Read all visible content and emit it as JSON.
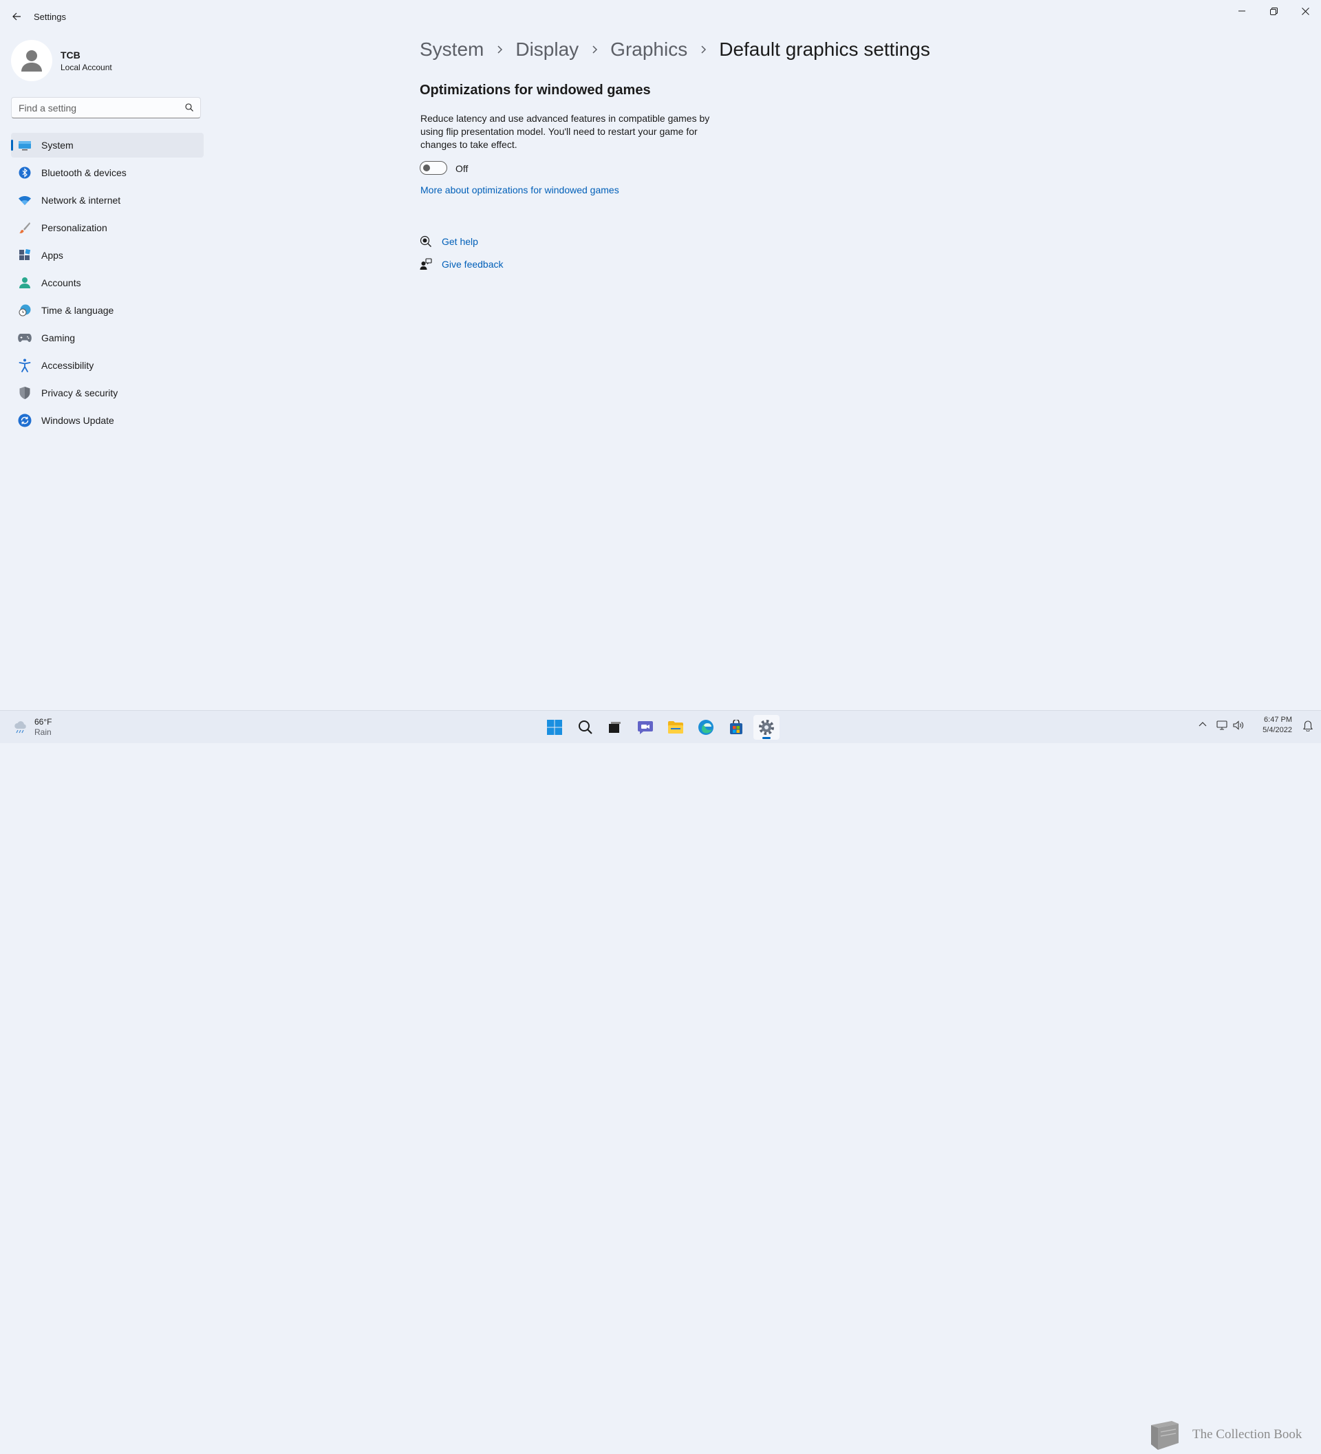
{
  "window": {
    "app_title": "Settings",
    "controls": {
      "minimize": "minimize-icon",
      "restore": "restore-icon",
      "close": "close-icon"
    }
  },
  "profile": {
    "name": "TCB",
    "account_type": "Local Account"
  },
  "search": {
    "placeholder": "Find a setting",
    "value": ""
  },
  "nav": {
    "selected": "System",
    "items": [
      {
        "label": "System",
        "icon": "display-icon"
      },
      {
        "label": "Bluetooth & devices",
        "icon": "bluetooth-icon"
      },
      {
        "label": "Network & internet",
        "icon": "wifi-icon"
      },
      {
        "label": "Personalization",
        "icon": "brush-icon"
      },
      {
        "label": "Apps",
        "icon": "apps-icon"
      },
      {
        "label": "Accounts",
        "icon": "person-icon"
      },
      {
        "label": "Time & language",
        "icon": "globe-clock-icon"
      },
      {
        "label": "Gaming",
        "icon": "gamepad-icon"
      },
      {
        "label": "Accessibility",
        "icon": "accessibility-icon"
      },
      {
        "label": "Privacy & security",
        "icon": "shield-icon"
      },
      {
        "label": "Windows Update",
        "icon": "update-icon"
      }
    ]
  },
  "breadcrumb": {
    "items": [
      "System",
      "Display",
      "Graphics"
    ],
    "current": "Default graphics settings"
  },
  "section": {
    "title": "Optimizations for windowed games",
    "description": "Reduce latency and use advanced features in compatible games by using flip presentation model. You'll need to restart your game for changes to take effect.",
    "toggle_state": "Off",
    "toggle_on": false,
    "more_link": "More about optimizations for windowed games"
  },
  "help": {
    "get_help": "Get help",
    "give_feedback": "Give feedback"
  },
  "taskbar": {
    "weather": {
      "temp": "66°F",
      "condition": "Rain"
    },
    "apps": [
      "start-icon",
      "search-icon",
      "task-view-icon",
      "chat-icon",
      "file-explorer-icon",
      "edge-icon",
      "store-icon",
      "settings-icon"
    ],
    "active_app": "settings-icon",
    "watermark": "The Collection Book",
    "time": "6:47 PM",
    "date": "5/4/2022"
  },
  "colors": {
    "accent": "#0067c0",
    "link": "#005fb8",
    "background": "#eef2f9"
  }
}
